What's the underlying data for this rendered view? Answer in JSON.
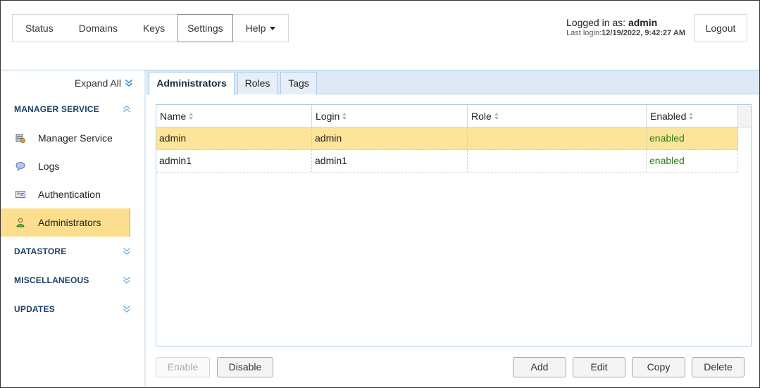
{
  "nav": {
    "items": [
      {
        "label": "Status"
      },
      {
        "label": "Domains"
      },
      {
        "label": "Keys"
      },
      {
        "label": "Settings",
        "active": true
      },
      {
        "label": "Help",
        "dropdown": true
      }
    ]
  },
  "session": {
    "logged_in_prefix": "Logged in as: ",
    "user": "admin",
    "last_login_prefix": "Last login:",
    "last_login": "12/19/2022, 9:42:27 AM",
    "logout_label": "Logout"
  },
  "sidebar": {
    "expand_all": "Expand All",
    "sections": [
      {
        "title": "MANAGER SERVICE",
        "expanded": true,
        "items": [
          {
            "label": "Manager Service",
            "icon": "server-icon"
          },
          {
            "label": "Logs",
            "icon": "speech-bubble-icon"
          },
          {
            "label": "Authentication",
            "icon": "id-card-icon"
          },
          {
            "label": "Administrators",
            "icon": "user-icon",
            "active": true
          }
        ]
      },
      {
        "title": "DATASTORE",
        "expanded": false
      },
      {
        "title": "MISCELLANEOUS",
        "expanded": false
      },
      {
        "title": "UPDATES",
        "expanded": false
      }
    ]
  },
  "tabs": [
    {
      "label": "Administrators",
      "active": true
    },
    {
      "label": "Roles"
    },
    {
      "label": "Tags"
    }
  ],
  "grid": {
    "columns": [
      "Name",
      "Login",
      "Role",
      "Enabled"
    ],
    "rows": [
      {
        "name": "admin",
        "login": "admin",
        "role": "",
        "enabled": "enabled",
        "selected": true
      },
      {
        "name": "admin1",
        "login": "admin1",
        "role": "",
        "enabled": "enabled",
        "selected": false
      }
    ]
  },
  "buttons": {
    "enable": "Enable",
    "disable": "Disable",
    "add": "Add",
    "edit": "Edit",
    "copy": "Copy",
    "delete": "Delete"
  },
  "colors": {
    "accent_blue": "#a9cde8",
    "selected_row": "#fce49a",
    "sidebar_active": "#fcdf8e",
    "section_title": "#1c3f66",
    "enabled_text": "#2a7b1a"
  }
}
